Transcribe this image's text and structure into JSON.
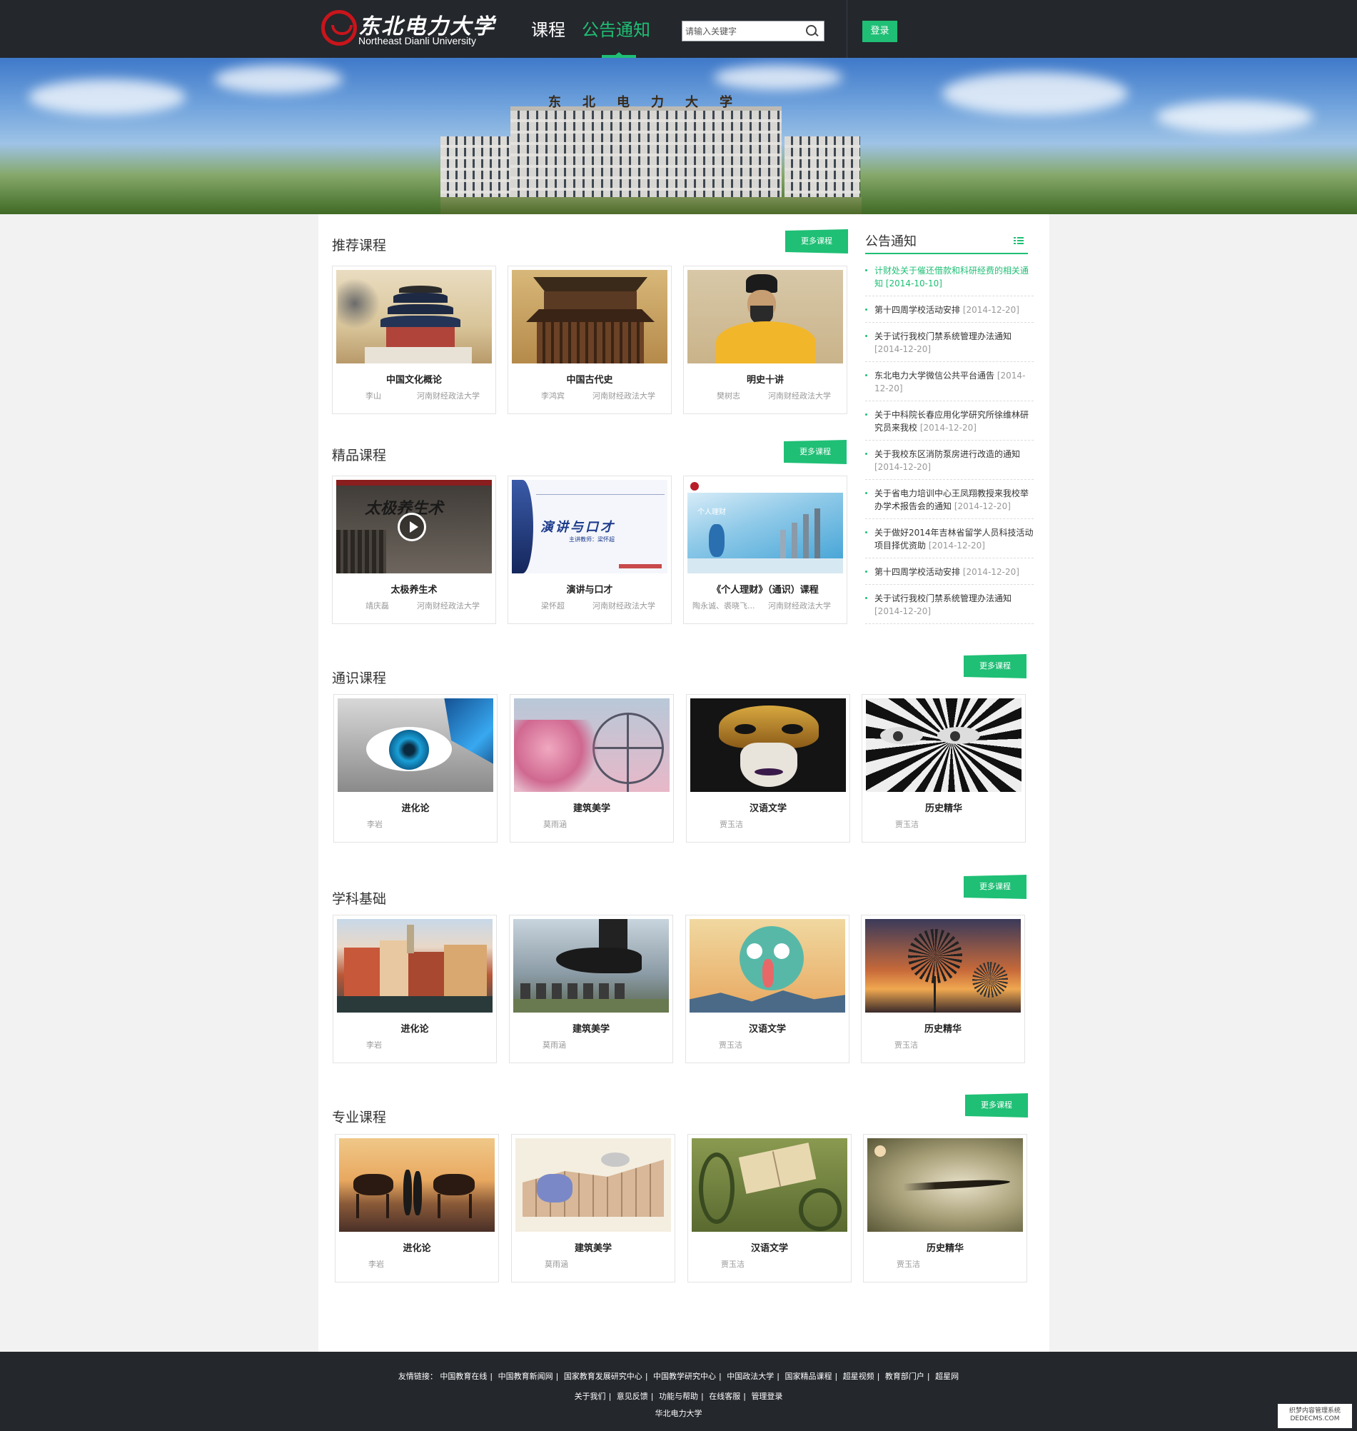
{
  "header": {
    "logo_cn": "东北电力大学",
    "logo_en": "Northeast Dianli University",
    "nav": [
      "课程",
      "公告通知"
    ],
    "search_placeholder": "请输入关键字",
    "login": "登录"
  },
  "banner": {
    "sign": "东北电力大学"
  },
  "more_label": "更多课程",
  "sections": {
    "recommended": {
      "title": "推荐课程",
      "cards": [
        {
          "name": "中国文化概论",
          "teacher": "李山",
          "school": "河南财经政法大学"
        },
        {
          "name": "中国古代史",
          "teacher": "李鸿宾",
          "school": "河南财经政法大学"
        },
        {
          "name": "明史十讲",
          "teacher": "樊树志",
          "school": "河南财经政法大学"
        }
      ]
    },
    "quality": {
      "title": "精品课程",
      "cards": [
        {
          "name": "太极养生术",
          "teacher": "靖庆磊",
          "school": "河南财经政法大学",
          "thumb_text": "太极养生术"
        },
        {
          "name": "演讲与口才",
          "teacher": "梁怀超",
          "school": "河南财经政法大学",
          "thumb_text": "演讲与口才",
          "thumb_sub": "主讲教师：梁怀超"
        },
        {
          "name": "《个人理财》（通识）课程",
          "teacher": "陶永诚、裘晓飞...",
          "school": "河南财经政法大学",
          "thumb_text": "个人理财"
        }
      ]
    },
    "general": {
      "title": "通识课程",
      "cards": [
        {
          "name": "进化论",
          "teacher": "李岩"
        },
        {
          "name": "建筑美学",
          "teacher": "莫雨涵"
        },
        {
          "name": "汉语文学",
          "teacher": "贾玉洁"
        },
        {
          "name": "历史精华",
          "teacher": "贾玉洁"
        }
      ]
    },
    "basics": {
      "title": "学科基础",
      "cards": [
        {
          "name": "进化论",
          "teacher": "李岩"
        },
        {
          "name": "建筑美学",
          "teacher": "莫雨涵"
        },
        {
          "name": "汉语文学",
          "teacher": "贾玉洁"
        },
        {
          "name": "历史精华",
          "teacher": "贾玉洁"
        }
      ]
    },
    "major": {
      "title": "专业课程",
      "cards": [
        {
          "name": "进化论",
          "teacher": "李岩"
        },
        {
          "name": "建筑美学",
          "teacher": "莫雨涵"
        },
        {
          "name": "汉语文学",
          "teacher": "贾玉洁"
        },
        {
          "name": "历史精华",
          "teacher": "贾玉洁"
        }
      ]
    }
  },
  "notices": {
    "title": "公告通知",
    "items": [
      {
        "text": "计财处关于催还借款和科研经费的相关通知",
        "date": "[2014-10-10]"
      },
      {
        "text": "第十四周学校活动安排",
        "date": "[2014-12-20]"
      },
      {
        "text": "关于试行我校门禁系统管理办法通知",
        "date": "[2014-12-20]"
      },
      {
        "text": "东北电力大学微信公共平台通告",
        "date": "[2014-12-20]"
      },
      {
        "text": "关于中科院长春应用化学研究所徐维林研究员来我校",
        "date": "[2014-12-20]"
      },
      {
        "text": "关于我校东区消防泵房进行改造的通知",
        "date": "[2014-12-20]"
      },
      {
        "text": "关于省电力培训中心王凤翔教授来我校举办学术报告会的通知",
        "date": "[2014-12-20]"
      },
      {
        "text": "关于做好2014年吉林省留学人员科技活动项目择优资助",
        "date": "[2014-12-20]"
      },
      {
        "text": "第十四周学校活动安排",
        "date": "[2014-12-20]"
      },
      {
        "text": "关于试行我校门禁系统管理办法通知",
        "date": "[2014-12-20]"
      }
    ]
  },
  "footer": {
    "links_label": "友情链接：",
    "links": [
      "中国教育在线",
      "中国教育新闻网",
      "国家教育发展研究中心",
      "中国教学研究中心",
      "中国政法大学",
      "国家精品课程",
      "超星视频",
      "教育部门户",
      "超星网"
    ],
    "links2": [
      "关于我们",
      "意见反馈",
      "功能与帮助",
      "在线客服",
      "管理登录"
    ],
    "copyright": "华北电力大学"
  },
  "watermark": {
    "line1": "织梦内容管理系统",
    "line2": "DEDECMS.COM"
  },
  "colors": {
    "accent": "#1fbf75",
    "header_bg": "#24272c",
    "logo_red": "#c8151b"
  }
}
